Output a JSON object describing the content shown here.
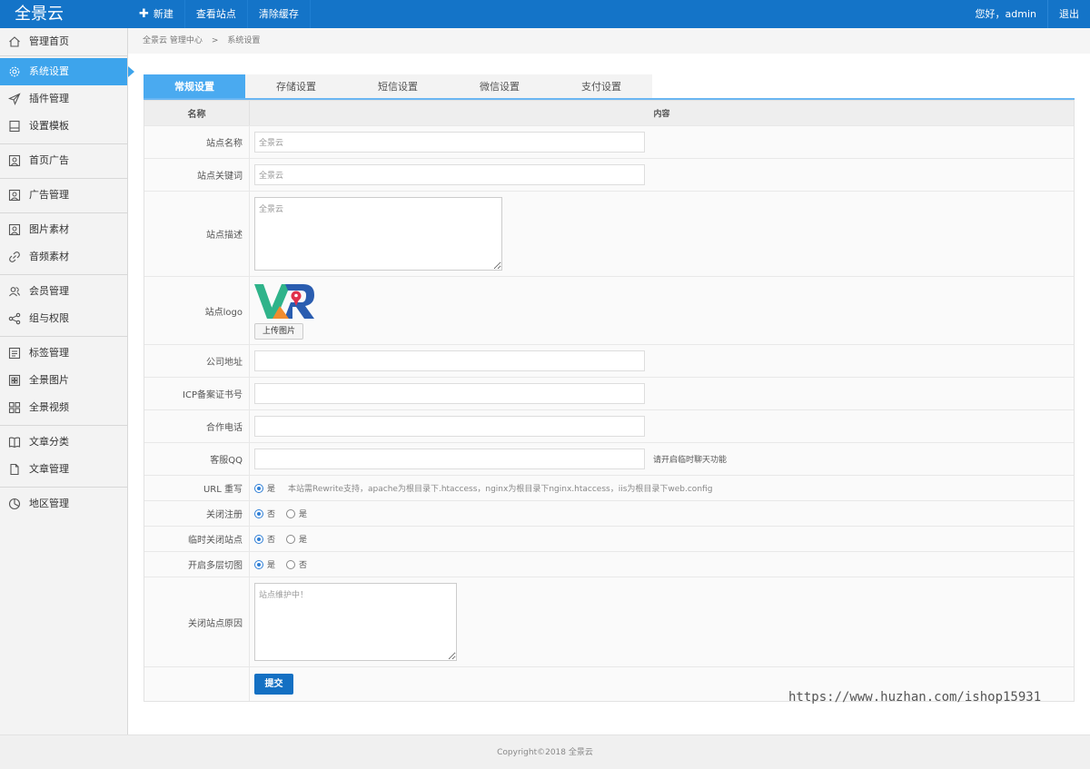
{
  "header": {
    "brand": "全景云",
    "nav": [
      {
        "label": "新建",
        "icon": "plus-icon"
      },
      {
        "label": "查看站点"
      },
      {
        "label": "清除缓存"
      }
    ],
    "greeting": "您好，admin",
    "logout": "退出",
    "accent": "#1474c8"
  },
  "sidebar": {
    "items": [
      {
        "label": "管理首页",
        "icon": "home-icon"
      },
      {
        "label": "系统设置",
        "icon": "gear-icon",
        "active": true
      },
      {
        "label": "插件管理",
        "icon": "send-icon"
      },
      {
        "label": "设置模板",
        "icon": "template-icon"
      },
      {
        "label": "首页广告",
        "icon": "portrait-icon"
      },
      {
        "label": "广告管理",
        "icon": "portrait-icon"
      },
      {
        "label": "图片素材",
        "icon": "image-icon"
      },
      {
        "label": "音频素材",
        "icon": "link-icon"
      },
      {
        "label": "会员管理",
        "icon": "users-icon"
      },
      {
        "label": "组与权限",
        "icon": "share-icon"
      },
      {
        "label": "标签管理",
        "icon": "list-icon"
      },
      {
        "label": "全景图片",
        "icon": "grid-icon"
      },
      {
        "label": "全景视频",
        "icon": "apps-icon"
      },
      {
        "label": "文章分类",
        "icon": "book-icon"
      },
      {
        "label": "文章管理",
        "icon": "file-icon"
      },
      {
        "label": "地区管理",
        "icon": "pie-icon"
      }
    ]
  },
  "breadcrumb": {
    "root": "全景云 管理中心",
    "separator": ">",
    "current": "系统设置"
  },
  "tabs": [
    "常规设置",
    "存储设置",
    "短信设置",
    "微信设置",
    "支付设置"
  ],
  "table": {
    "col_name": "名称",
    "col_content": "内容"
  },
  "form": {
    "site_name": {
      "label": "站点名称",
      "value": "全景云"
    },
    "site_keywords": {
      "label": "站点关键词",
      "value": "全景云"
    },
    "site_desc": {
      "label": "站点描述",
      "value": "全景云"
    },
    "site_logo": {
      "label": "站点logo",
      "upload": "上传图片"
    },
    "address": {
      "label": "公司地址",
      "value": ""
    },
    "icp": {
      "label": "ICP备案证书号",
      "value": ""
    },
    "phone": {
      "label": "合作电话",
      "value": ""
    },
    "qq": {
      "label": "客服QQ",
      "value": "",
      "hint": "请开启临时聊天功能"
    },
    "rewrite": {
      "label": "URL 重写",
      "option": "是",
      "note": "本站需Rewrite支持，apache为根目录下.htaccess，nginx为根目录下nginx.htaccess，iis为根目录下web.config"
    },
    "close_reg": {
      "label": "关闭注册",
      "options": [
        "否",
        "是"
      ],
      "selected": "否"
    },
    "close_site": {
      "label": "临时关闭站点",
      "options": [
        "否",
        "是"
      ],
      "selected": "否"
    },
    "multi_tile": {
      "label": "开启多层切图",
      "options": [
        "是",
        "否"
      ],
      "selected": "是"
    },
    "close_reason": {
      "label": "关闭站点原因",
      "value": "站点维护中！"
    },
    "submit": "提交"
  },
  "watermark": "https://www.huzhan.com/ishop15931",
  "footer": {
    "copyright": "Copyright©2018   全景云"
  }
}
